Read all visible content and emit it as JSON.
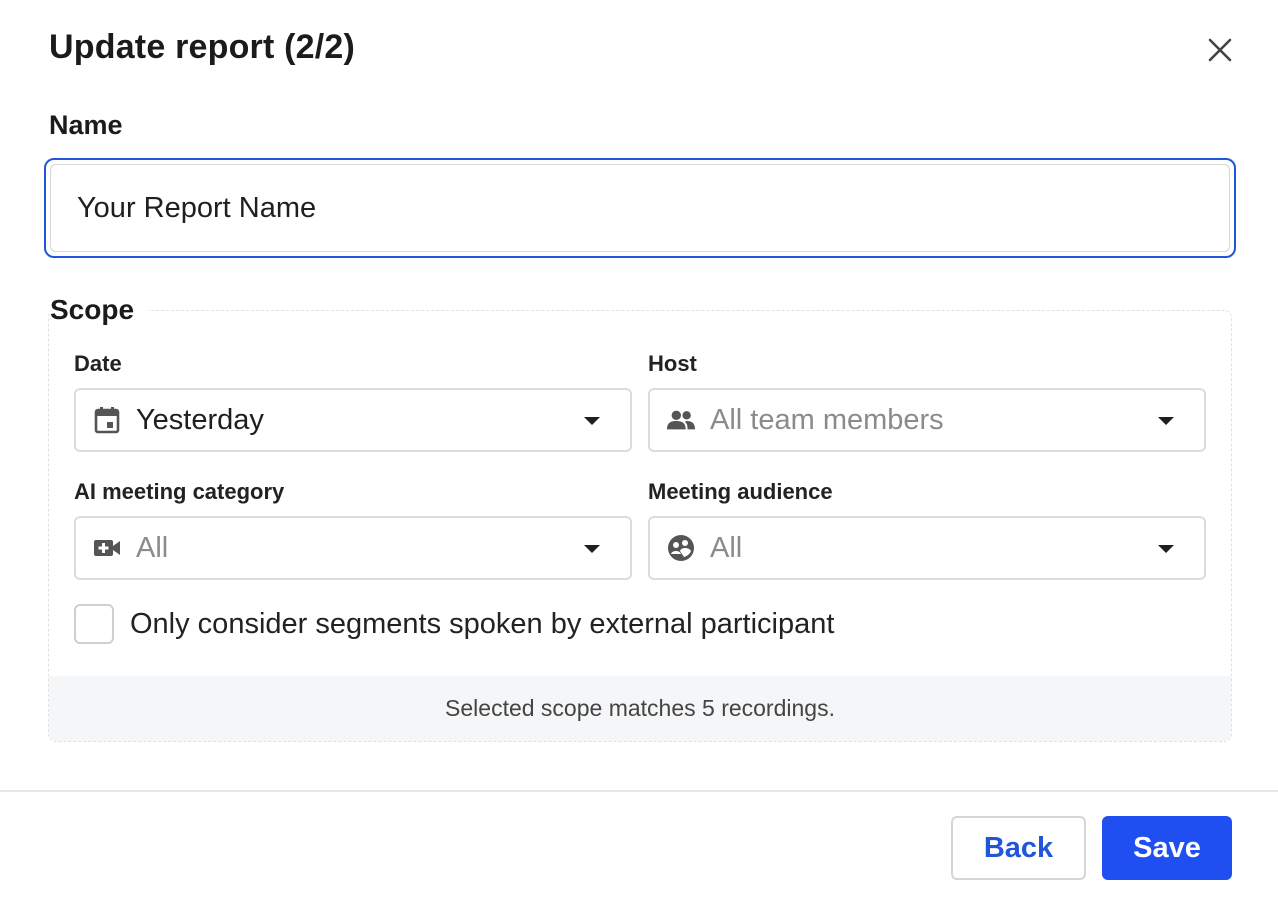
{
  "dialog": {
    "title": "Update report (2/2)"
  },
  "name": {
    "label": "Name",
    "value": "Your Report Name"
  },
  "scope": {
    "label": "Scope",
    "date": {
      "label": "Date",
      "value": "Yesterday",
      "icon": "calendar-icon"
    },
    "host": {
      "label": "Host",
      "value": "All team members",
      "icon": "people-icon"
    },
    "category": {
      "label": "AI meeting category",
      "value": "All",
      "icon": "video-add-icon"
    },
    "audience": {
      "label": "Meeting audience",
      "value": "All",
      "icon": "group-circle-icon"
    },
    "external_only": {
      "label": "Only consider segments spoken by external participant",
      "checked": false
    },
    "match_text": "Selected scope matches 5 recordings."
  },
  "footer": {
    "back_label": "Back",
    "save_label": "Save"
  },
  "colors": {
    "accent": "#1f4ff0",
    "focus_border": "#2156d9",
    "muted_text": "#8b8b8b"
  }
}
